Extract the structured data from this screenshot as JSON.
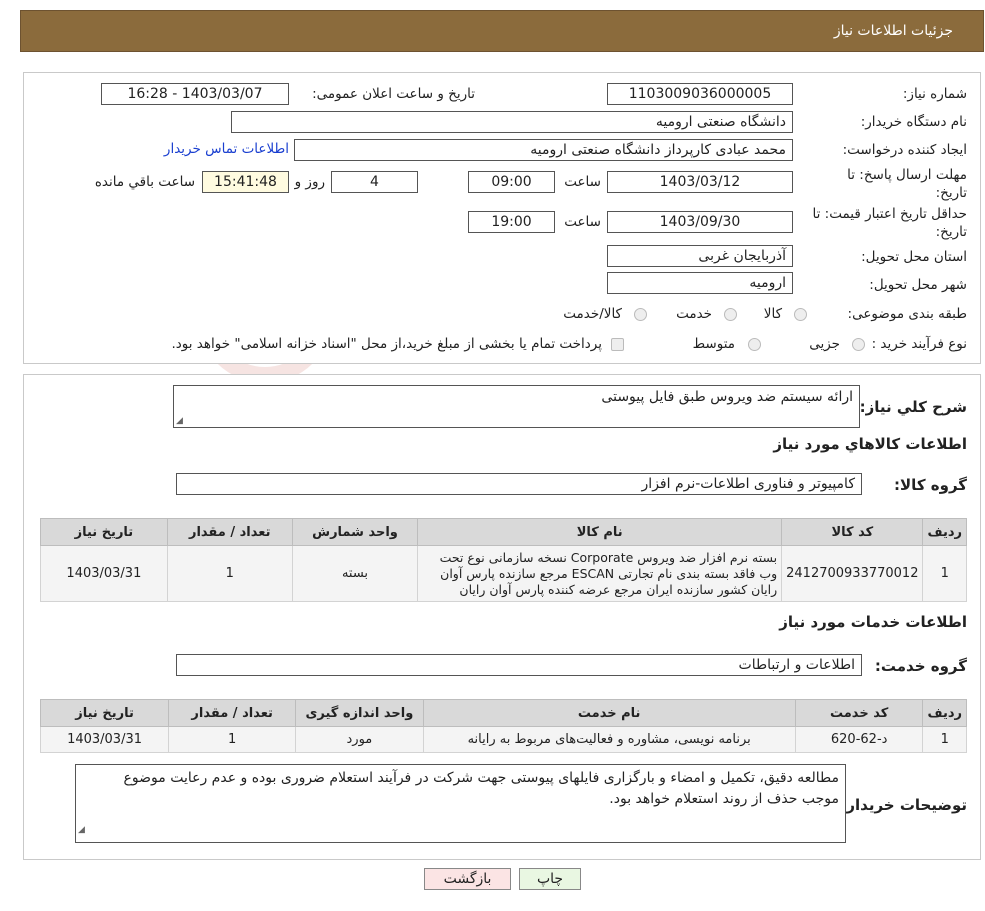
{
  "page_title": "جزئیات اطلاعات نیاز",
  "watermark": "AriaTender.neT",
  "form": {
    "need_number_label": "شماره نیاز:",
    "need_number": "1103009036000005",
    "announce_label": "تاریخ و ساعت اعلان عمومی:",
    "announce_value": "1403/03/07 - 16:28",
    "buyer_label": "نام دستگاه خریدار:",
    "buyer_value": "دانشگاه صنعتی ارومیه",
    "creator_label": "ایجاد کننده درخواست:",
    "creator_value": "محمد عبادی کارپرداز دانشگاه صنعتی ارومیه",
    "contact_link": "اطلاعات تماس خریدار",
    "deadline_label": "مهلت ارسال پاسخ: تا تاریخ:",
    "deadline_date": "1403/03/12",
    "time_label": "ساعت",
    "deadline_time": "09:00",
    "days_value": "4",
    "days_label": "روز و",
    "remaining_time": "15:41:48",
    "remaining_label": "ساعت باقي مانده",
    "validity_label": "حداقل تاریخ اعتبار قیمت: تا تاریخ:",
    "validity_date": "1403/09/30",
    "validity_time": "19:00",
    "province_label": "استان محل تحویل:",
    "province_value": "آذربایجان غربی",
    "city_label": "شهر محل تحویل:",
    "city_value": "ارومیه",
    "category_label": "طبقه بندی موضوعی:",
    "category_options": [
      "کالا",
      "خدمت",
      "کالا/خدمت"
    ],
    "process_label": "نوع فرآیند خرید :",
    "process_options": [
      "جزیی",
      "متوسط"
    ],
    "payment_note": "پرداخت تمام یا بخشی از مبلغ خرید،از محل \"اسناد خزانه اسلامی\" خواهد بود."
  },
  "summary": {
    "desc_label": "شرح کلي نياز:",
    "desc_value": "ارائه سیستم ضد ویروس طبق فایل پیوستی",
    "goods_heading": "اطلاعات کالاهاي مورد نياز",
    "goods_group_label": "گروه کالا:",
    "goods_group_value": "کامپیوتر و فناوری اطلاعات-نرم افزار",
    "goods_headers": [
      "ردیف",
      "کد کالا",
      "نام کالا",
      "واحد شمارش",
      "تعداد / مقدار",
      "تاریخ نیاز"
    ],
    "goods_rows": [
      [
        "1",
        "2412700933770012",
        "بسته نرم افزار ضد ویروس Corporate نسخه سازمانی نوع تحت وب فاقد بسته بندی نام تجارتی ESCAN مرجع سازنده پارس آوان رایان کشور سازنده ایران مرجع عرضه کننده پارس آوان رایان",
        "بسته",
        "1",
        "1403/03/31"
      ]
    ],
    "services_heading": "اطلاعات خدمات مورد نياز",
    "service_group_label": "گروه خدمت:",
    "service_group_value": "اطلاعات و ارتباطات",
    "service_headers": [
      "ردیف",
      "کد خدمت",
      "نام خدمت",
      "واحد اندازه گیری",
      "تعداد / مقدار",
      "تاریخ نیاز"
    ],
    "service_rows": [
      [
        "1",
        "د-62-620",
        "برنامه نویسی، مشاوره و فعالیت‌های مربوط به رایانه",
        "مورد",
        "1",
        "1403/03/31"
      ]
    ],
    "buyer_notes_label": "توضیحات خریدار:",
    "buyer_notes_value": "مطالعه دقیق، تکمیل و امضاء و بارگزاری فایلهای پیوستی جهت شرکت در فرآیند استعلام ضروری بوده و عدم رعایت موضوع موجب حذف از روند استعلام خواهد بود."
  },
  "buttons": {
    "print": "چاپ",
    "back": "بازگشت"
  },
  "colors": {
    "title_bar": "#8b6b3c",
    "link": "#1a3fd0",
    "print_btn": "#e9f7e2",
    "back_btn": "#fbe4e4"
  }
}
